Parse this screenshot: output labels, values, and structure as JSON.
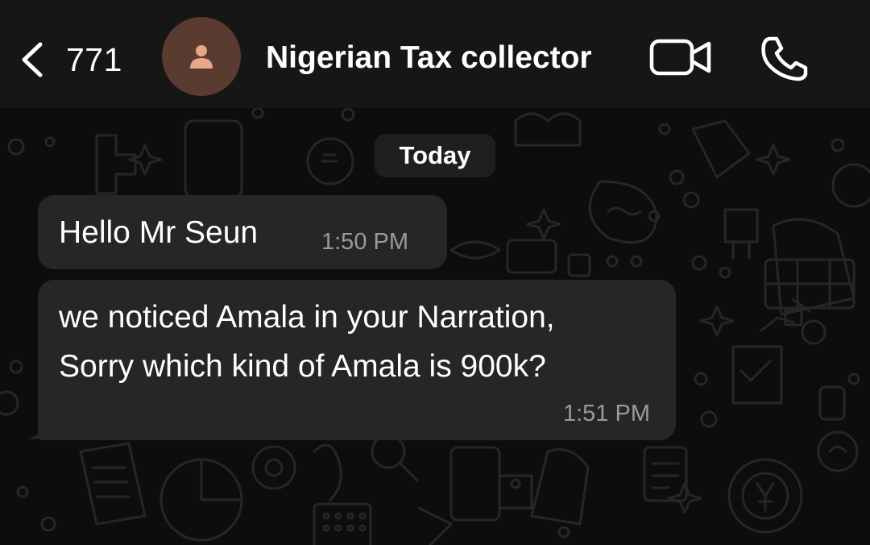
{
  "header": {
    "back_count": "771",
    "contact_name": "Nigerian Tax collector",
    "icons": {
      "back": "chevron-left-icon",
      "avatar": "person-icon",
      "video": "video-camera-icon",
      "call": "phone-icon"
    }
  },
  "chat": {
    "date_label": "Today",
    "messages": [
      {
        "direction": "incoming",
        "lines": [
          "Hello Mr Seun"
        ],
        "time": "1:50 PM"
      },
      {
        "direction": "incoming",
        "lines": [
          "we noticed Amala in your Narration,",
          "Sorry which kind of Amala is 900k?"
        ],
        "time": "1:51 PM"
      }
    ]
  },
  "colors": {
    "background": "#0d0d0d",
    "header": "#161616",
    "bubble": "#262626",
    "avatar_bg": "#5a3b2f",
    "avatar_icon": "#e8a68a",
    "timestamp": "#9a9a9a"
  }
}
